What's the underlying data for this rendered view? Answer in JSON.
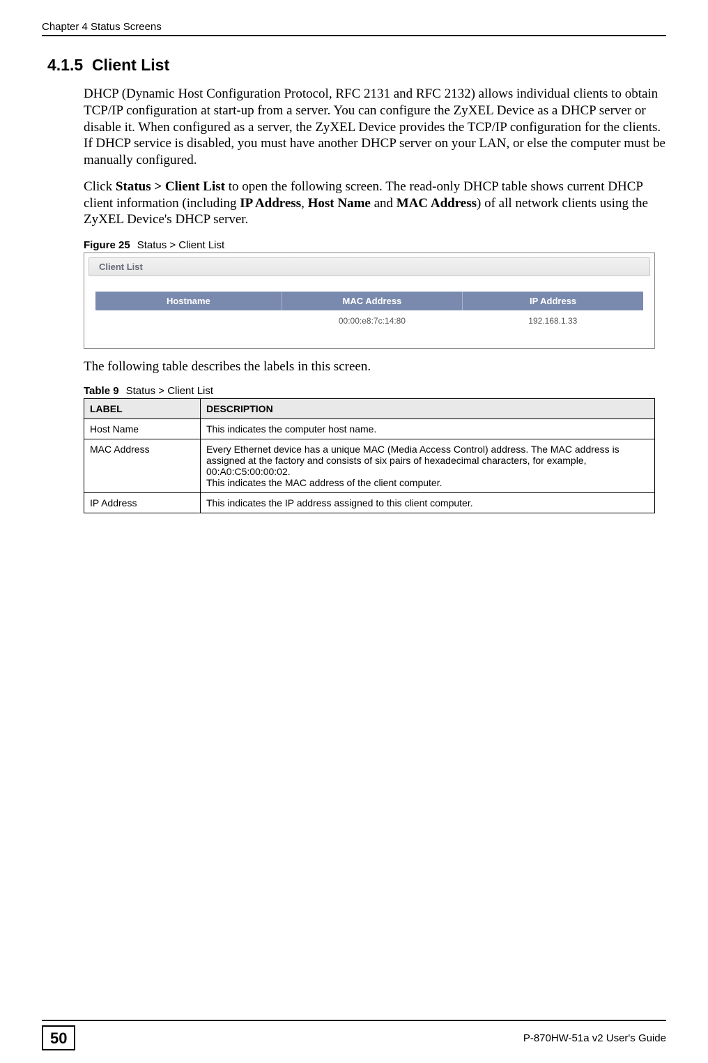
{
  "header": {
    "chapter": "Chapter 4 Status Screens"
  },
  "section": {
    "number": "4.1.5",
    "title": "Client List"
  },
  "paragraphs": {
    "p1": "DHCP (Dynamic Host Configuration Protocol, RFC 2131 and RFC 2132) allows individual clients to obtain TCP/IP configuration at start-up from a server. You can configure the ZyXEL Device as a DHCP server or disable it. When configured as a server, the ZyXEL Device provides the TCP/IP configuration for the clients. If DHCP service is disabled, you must have another DHCP server on your LAN, or else the computer must be manually configured.",
    "p2_pre": "Click ",
    "p2_bold1": "Status > Client List",
    "p2_mid1": " to open the following screen. The read-only DHCP table shows current DHCP client information (including ",
    "p2_bold2": "IP Address",
    "p2_mid2": ", ",
    "p2_bold3": "Host Name",
    "p2_mid3": " and ",
    "p2_bold4": "MAC Address",
    "p2_mid4": ") of all network clients using the ZyXEL Device's DHCP server.",
    "p3": "The following table describes the labels in this screen."
  },
  "figure": {
    "label": "Figure 25",
    "title": "Status > Client List",
    "panel_title": "Client List",
    "columns": {
      "c1": "Hostname",
      "c2": "MAC Address",
      "c3": "IP Address"
    },
    "row": {
      "hostname": "",
      "mac": "00:00:e8:7c:14:80",
      "ip": "192.168.1.33"
    }
  },
  "table": {
    "label": "Table 9",
    "title": "Status > Client List",
    "head": {
      "c1": "LABEL",
      "c2": "DESCRIPTION"
    },
    "rows": [
      {
        "label": "Host Name",
        "desc": "This indicates the computer host name."
      },
      {
        "label": "MAC Address",
        "desc": "Every Ethernet device has a unique MAC (Media Access Control) address. The MAC address is assigned at the factory and consists of six pairs of hexadecimal characters, for example, 00:A0:C5:00:00:02.\nThis indicates the MAC address of the client computer."
      },
      {
        "label": "IP Address",
        "desc": "This indicates the IP address assigned to this client computer."
      }
    ]
  },
  "footer": {
    "pagenum": "50",
    "guide": "P-870HW-51a v2 User's Guide"
  }
}
